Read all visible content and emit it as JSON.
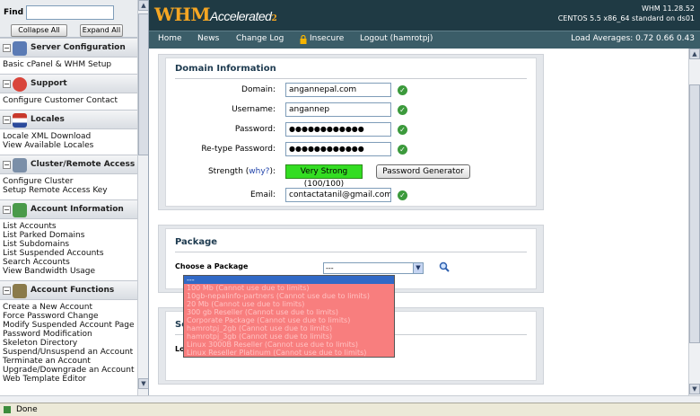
{
  "sidebar": {
    "find_label": "Find",
    "find_value": "",
    "collapse_label": "Collapse All",
    "expand_label": "Expand All",
    "sections": [
      {
        "title": "Server Configuration",
        "icon": "server-config-icon",
        "links": [
          "Basic cPanel & WHM Setup"
        ]
      },
      {
        "title": "Support",
        "icon": "support-icon",
        "links": [
          "Configure Customer Contact"
        ]
      },
      {
        "title": "Locales",
        "icon": "locales-icon",
        "links": [
          "Locale XML Download",
          "View Available Locales"
        ]
      },
      {
        "title": "Cluster/Remote Access",
        "icon": "cluster-icon",
        "links": [
          "Configure Cluster",
          "Setup Remote Access Key"
        ]
      },
      {
        "title": "Account Information",
        "icon": "account-info-icon",
        "links": [
          "List Accounts",
          "List Parked Domains",
          "List Subdomains",
          "List Suspended Accounts",
          "Search Accounts",
          "View Bandwidth Usage"
        ]
      },
      {
        "title": "Account Functions",
        "icon": "account-functions-icon",
        "links": [
          "Create a New Account",
          "Force Password Change",
          "Modify Suspended Account Page",
          "Password Modification",
          "Skeleton Directory",
          "Suspend/Unsuspend an Account",
          "Terminate an Account",
          "Upgrade/Downgrade an Account",
          "Web Template Editor"
        ]
      }
    ]
  },
  "header": {
    "logo_main": "WHM",
    "logo_sub": "Accelerated",
    "logo_num": "2",
    "version": "WHM 11.28.52",
    "os": "CENTOS 5.5 x86_64 standard on ds01"
  },
  "nav": {
    "home": "Home",
    "news": "News",
    "changelog": "Change Log",
    "insecure": "Insecure",
    "logout": "Logout (hamrotpj)",
    "load": "Load Averages: 0.72 0.66 0.43"
  },
  "domain_info": {
    "title": "Domain Information",
    "domain_label": "Domain:",
    "domain_value": "angannepal.com",
    "username_label": "Username:",
    "username_value": "angannep",
    "password_label": "Password:",
    "password_value": "●●●●●●●●●●●●",
    "retype_label": "Re-type Password:",
    "retype_value": "●●●●●●●●●●●●",
    "strength_label": "Strength (",
    "strength_why": "why?",
    "strength_end": "):",
    "strength_value": "Very Strong (100/100)",
    "pwgen_label": "Password Generator",
    "email_label": "Email:",
    "email_value": "contactatanil@gmail.com"
  },
  "package": {
    "title": "Package",
    "choose_label": "Choose a Package",
    "selected": "---",
    "options": [
      "---",
      "100 Mb (Cannot use due to limits)",
      "10gb-nepalinfo-partners (Cannot use due to limits)",
      "20 Mb (Cannot use due to limits)",
      "300 gb Reseller (Cannot use due to limits)",
      "Corporate Package (Cannot use due to limits)",
      "hamrotpj_2gb (Cannot use due to limits)",
      "hamrotpj_3gb (Cannot use due to limits)",
      "Linux 3000B Reseller (Cannot use due to limits)",
      "Linux Reseller Platinum (Cannot use due to limits)"
    ]
  },
  "settings": {
    "title": "Settings",
    "locale_label": "Locale"
  },
  "status": {
    "text": "Done"
  },
  "colors": {
    "header_bg": "#1f3a44",
    "nav_bg": "#3b5d68",
    "logo": "#f5a623",
    "strength_bg": "#33dd22",
    "dropdown_bg": "#f87e7e",
    "dropdown_selected": "#3169c6"
  }
}
